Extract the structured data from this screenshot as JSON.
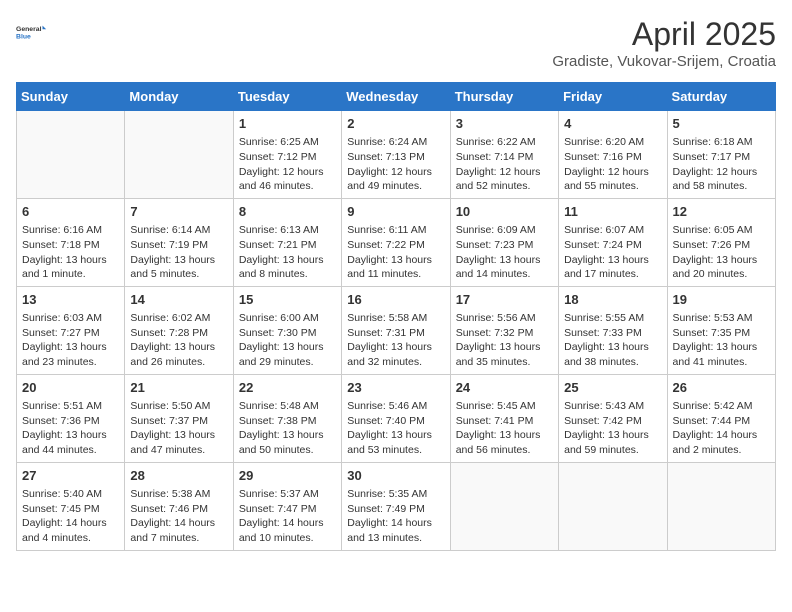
{
  "header": {
    "logo_line1": "General",
    "logo_line2": "Blue",
    "month": "April 2025",
    "location": "Gradiste, Vukovar-Srijem, Croatia"
  },
  "weekdays": [
    "Sunday",
    "Monday",
    "Tuesday",
    "Wednesday",
    "Thursday",
    "Friday",
    "Saturday"
  ],
  "weeks": [
    [
      {
        "day": "",
        "info": ""
      },
      {
        "day": "",
        "info": ""
      },
      {
        "day": "1",
        "info": "Sunrise: 6:25 AM\nSunset: 7:12 PM\nDaylight: 12 hours and 46 minutes."
      },
      {
        "day": "2",
        "info": "Sunrise: 6:24 AM\nSunset: 7:13 PM\nDaylight: 12 hours and 49 minutes."
      },
      {
        "day": "3",
        "info": "Sunrise: 6:22 AM\nSunset: 7:14 PM\nDaylight: 12 hours and 52 minutes."
      },
      {
        "day": "4",
        "info": "Sunrise: 6:20 AM\nSunset: 7:16 PM\nDaylight: 12 hours and 55 minutes."
      },
      {
        "day": "5",
        "info": "Sunrise: 6:18 AM\nSunset: 7:17 PM\nDaylight: 12 hours and 58 minutes."
      }
    ],
    [
      {
        "day": "6",
        "info": "Sunrise: 6:16 AM\nSunset: 7:18 PM\nDaylight: 13 hours and 1 minute."
      },
      {
        "day": "7",
        "info": "Sunrise: 6:14 AM\nSunset: 7:19 PM\nDaylight: 13 hours and 5 minutes."
      },
      {
        "day": "8",
        "info": "Sunrise: 6:13 AM\nSunset: 7:21 PM\nDaylight: 13 hours and 8 minutes."
      },
      {
        "day": "9",
        "info": "Sunrise: 6:11 AM\nSunset: 7:22 PM\nDaylight: 13 hours and 11 minutes."
      },
      {
        "day": "10",
        "info": "Sunrise: 6:09 AM\nSunset: 7:23 PM\nDaylight: 13 hours and 14 minutes."
      },
      {
        "day": "11",
        "info": "Sunrise: 6:07 AM\nSunset: 7:24 PM\nDaylight: 13 hours and 17 minutes."
      },
      {
        "day": "12",
        "info": "Sunrise: 6:05 AM\nSunset: 7:26 PM\nDaylight: 13 hours and 20 minutes."
      }
    ],
    [
      {
        "day": "13",
        "info": "Sunrise: 6:03 AM\nSunset: 7:27 PM\nDaylight: 13 hours and 23 minutes."
      },
      {
        "day": "14",
        "info": "Sunrise: 6:02 AM\nSunset: 7:28 PM\nDaylight: 13 hours and 26 minutes."
      },
      {
        "day": "15",
        "info": "Sunrise: 6:00 AM\nSunset: 7:30 PM\nDaylight: 13 hours and 29 minutes."
      },
      {
        "day": "16",
        "info": "Sunrise: 5:58 AM\nSunset: 7:31 PM\nDaylight: 13 hours and 32 minutes."
      },
      {
        "day": "17",
        "info": "Sunrise: 5:56 AM\nSunset: 7:32 PM\nDaylight: 13 hours and 35 minutes."
      },
      {
        "day": "18",
        "info": "Sunrise: 5:55 AM\nSunset: 7:33 PM\nDaylight: 13 hours and 38 minutes."
      },
      {
        "day": "19",
        "info": "Sunrise: 5:53 AM\nSunset: 7:35 PM\nDaylight: 13 hours and 41 minutes."
      }
    ],
    [
      {
        "day": "20",
        "info": "Sunrise: 5:51 AM\nSunset: 7:36 PM\nDaylight: 13 hours and 44 minutes."
      },
      {
        "day": "21",
        "info": "Sunrise: 5:50 AM\nSunset: 7:37 PM\nDaylight: 13 hours and 47 minutes."
      },
      {
        "day": "22",
        "info": "Sunrise: 5:48 AM\nSunset: 7:38 PM\nDaylight: 13 hours and 50 minutes."
      },
      {
        "day": "23",
        "info": "Sunrise: 5:46 AM\nSunset: 7:40 PM\nDaylight: 13 hours and 53 minutes."
      },
      {
        "day": "24",
        "info": "Sunrise: 5:45 AM\nSunset: 7:41 PM\nDaylight: 13 hours and 56 minutes."
      },
      {
        "day": "25",
        "info": "Sunrise: 5:43 AM\nSunset: 7:42 PM\nDaylight: 13 hours and 59 minutes."
      },
      {
        "day": "26",
        "info": "Sunrise: 5:42 AM\nSunset: 7:44 PM\nDaylight: 14 hours and 2 minutes."
      }
    ],
    [
      {
        "day": "27",
        "info": "Sunrise: 5:40 AM\nSunset: 7:45 PM\nDaylight: 14 hours and 4 minutes."
      },
      {
        "day": "28",
        "info": "Sunrise: 5:38 AM\nSunset: 7:46 PM\nDaylight: 14 hours and 7 minutes."
      },
      {
        "day": "29",
        "info": "Sunrise: 5:37 AM\nSunset: 7:47 PM\nDaylight: 14 hours and 10 minutes."
      },
      {
        "day": "30",
        "info": "Sunrise: 5:35 AM\nSunset: 7:49 PM\nDaylight: 14 hours and 13 minutes."
      },
      {
        "day": "",
        "info": ""
      },
      {
        "day": "",
        "info": ""
      },
      {
        "day": "",
        "info": ""
      }
    ]
  ]
}
